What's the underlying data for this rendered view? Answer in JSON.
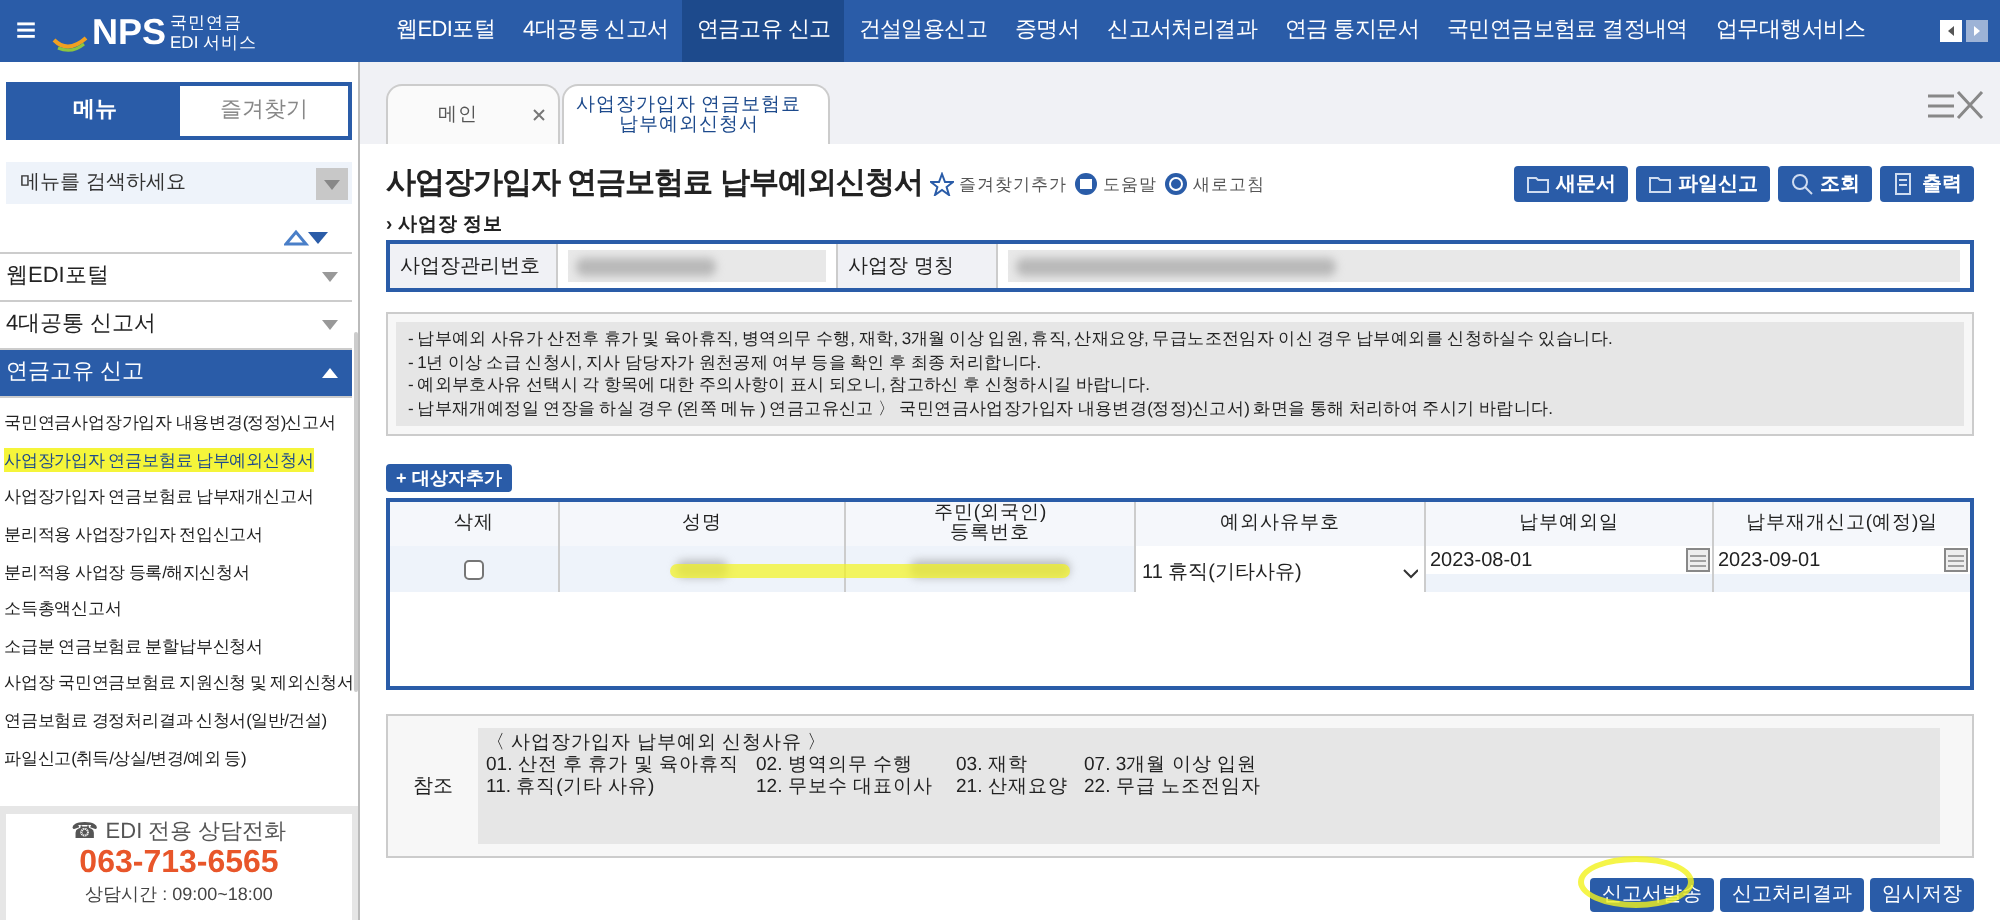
{
  "header": {
    "logo_text": "NPS",
    "logo_sub1": "국민연금",
    "logo_sub2": "EDI 서비스",
    "menu_icon": "≡",
    "nav": [
      {
        "label": "웹EDI포털",
        "selected": false
      },
      {
        "label": "4대공통 신고서",
        "selected": false
      },
      {
        "label": "연금고유 신고",
        "selected": true
      },
      {
        "label": "건설일용신고",
        "selected": false
      },
      {
        "label": "증명서",
        "selected": false
      },
      {
        "label": "신고서처리결과",
        "selected": false
      },
      {
        "label": "연금 통지문서",
        "selected": false
      },
      {
        "label": "국민연금보험료 결정내역",
        "selected": false
      },
      {
        "label": "업무대행서비스",
        "selected": false
      }
    ]
  },
  "sidebar": {
    "tabs": [
      {
        "label": "메뉴",
        "selected": true
      },
      {
        "label": "즐겨찾기",
        "selected": false
      }
    ],
    "search": {
      "placeholder": "메뉴를 검색하세요"
    },
    "groups": [
      {
        "label": "웹EDI포털",
        "expanded": false
      },
      {
        "label": "4대공통 신고서",
        "expanded": false
      },
      {
        "label": "연금고유 신고",
        "expanded": true,
        "children": [
          {
            "label": "국민연금사업장가입자 내용변경(정정)신고서",
            "highlighted": false
          },
          {
            "label": "사업장가입자 연금보험료 납부예외신청서",
            "highlighted": true
          },
          {
            "label": "사업장가입자 연금보험료 납부재개신고서",
            "highlighted": false
          },
          {
            "label": "분리적용 사업장가입자 전입신고서",
            "highlighted": false
          },
          {
            "label": "분리적용 사업장 등록/해지신청서",
            "highlighted": false
          },
          {
            "label": "소득총액신고서",
            "highlighted": false
          },
          {
            "label": "소급분 연금보험료 분할납부신청서",
            "highlighted": false
          },
          {
            "label": "사업장 국민연금보험료 지원신청 및 제외신청서",
            "highlighted": false
          },
          {
            "label": "연금보험료 경정처리결과 신청서(일반/건설)",
            "highlighted": false
          },
          {
            "label": "파일신고(취득/상실/변경/예외 등)",
            "highlighted": false
          }
        ]
      }
    ],
    "contact": {
      "title": "☎ EDI 전용 상담전화",
      "phone": "063-713-6565",
      "hours": "상담시간 : 09:00~18:00"
    }
  },
  "tabs": [
    {
      "label": "메인",
      "selected": false
    },
    {
      "label": "사업장가입자 연금보험료\n납부예외신청서",
      "selected": true
    }
  ],
  "page": {
    "title": "사업장가입자 연금보험료 납부예외신청서",
    "links": [
      "즐겨찾기추가",
      "도움말",
      "새로고침"
    ],
    "toolbar": [
      "새문서",
      "파일신고",
      "조회",
      "출력"
    ]
  },
  "workplace": {
    "heading": "› 사업장 정보",
    "fields": [
      {
        "label": "사업장관리번호"
      },
      {
        "label": "사업장 명칭"
      }
    ]
  },
  "notices": [
    "- 납부예외 사유가 산전후 휴가 및 육아휴직, 병역의무 수행, 재학, 3개월 이상 입원, 휴직, 산재요양, 무급노조전임자 이신 경우 납부예외를 신청하실수 있습니다.",
    "- 1년 이상 소급 신청시, 지사 담당자가 원천공제 여부 등을 확인 후 최종 처리합니다.",
    "- 예외부호사유 선택시 각 항목에 대한 주의사항이 표시 되오니, 참고하신 후 신청하시길 바랍니다.",
    "- 납부재개예정일 연장을 하실 경우 (왼쪽 메뉴 ) 연금고유신고 〉 국민연금사업장가입자 내용변경(정정)신고서) 화면을 통해 처리하여 주시기 바랍니다."
  ],
  "table": {
    "add_button": "+ 대상자추가",
    "columns": [
      "삭제",
      "성명",
      "주민(외국인)\n등록번호",
      "예외사유부호",
      "납부예외일",
      "납부재개신고(예정)일"
    ],
    "rows": [
      {
        "checked": false,
        "highlighted": true,
        "reason": "11 휴직(기타사유)",
        "exception_date": "2023-08-01",
        "resume_date": "2023-09-01"
      }
    ]
  },
  "reference": {
    "label": "참조",
    "title": "〈 사업장가입자 납부예외 신청사유 〉",
    "rows": [
      [
        "01. 산전 후 휴가 및 육아휴직",
        "02. 병역의무 수행",
        "03. 재학",
        "07. 3개월 이상 입원"
      ],
      [
        "11. 휴직(기타 사유)",
        "12. 무보수 대표이사",
        "21. 산재요양",
        "22. 무급 노조전임자"
      ]
    ]
  },
  "actions": [
    {
      "label": "신고서발송",
      "circled": true
    },
    {
      "label": "신고처리결과",
      "circled": false
    },
    {
      "label": "임시저장",
      "circled": false
    }
  ]
}
